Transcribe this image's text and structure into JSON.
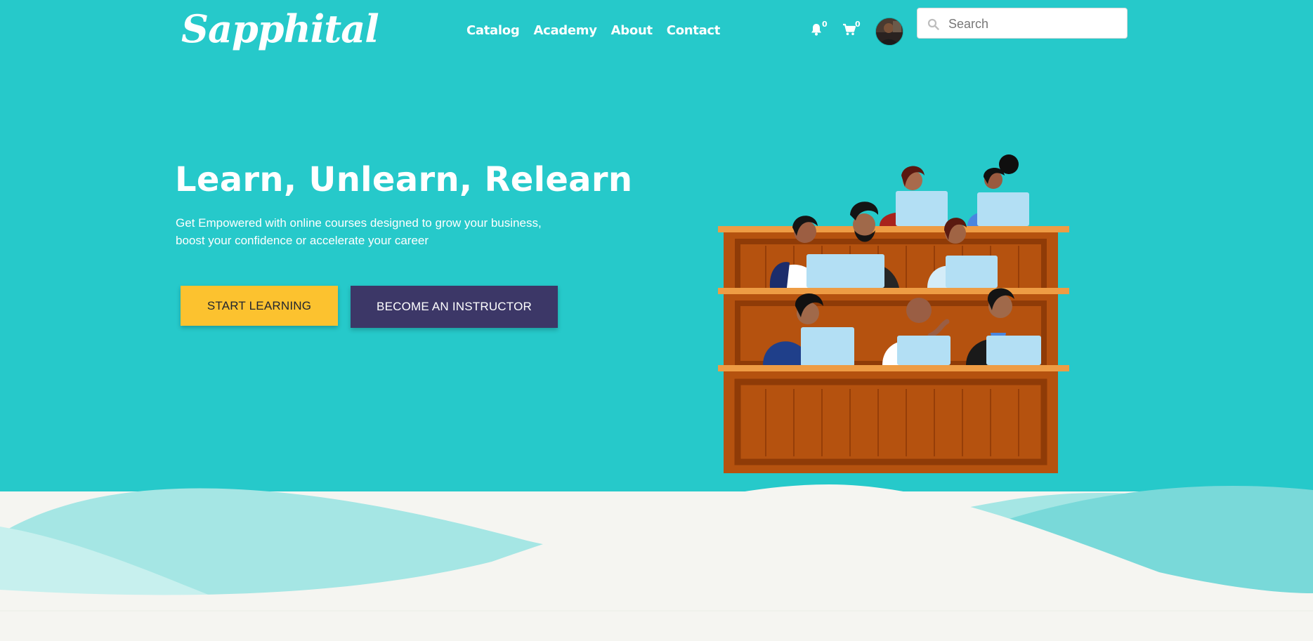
{
  "header": {
    "brand": "Sapphital",
    "nav": [
      {
        "label": "Catalog"
      },
      {
        "label": "Academy"
      },
      {
        "label": "About"
      },
      {
        "label": "Contact"
      }
    ],
    "notifications_count": "0",
    "cart_count": "0",
    "search_placeholder": "Search"
  },
  "hero": {
    "title": "Learn, Unlearn, Relearn",
    "subtitle_line1": "Get Empowered with online courses designed to grow your business,",
    "subtitle_line2": "boost your confidence or accelerate your career",
    "primary_button": "START LEARNING",
    "secondary_button": "BECOME AN INSTRUCTOR"
  },
  "colors": {
    "hero_background": "#26c9ca",
    "page_background": "#f5f5f1",
    "primary_button": "#fcc22f",
    "secondary_button": "#3c3767",
    "laptop": "#b3dff4",
    "desk": "#b5520f"
  },
  "icons": {
    "notifications": "bell-icon",
    "cart": "cart-icon",
    "search": "search-icon"
  }
}
